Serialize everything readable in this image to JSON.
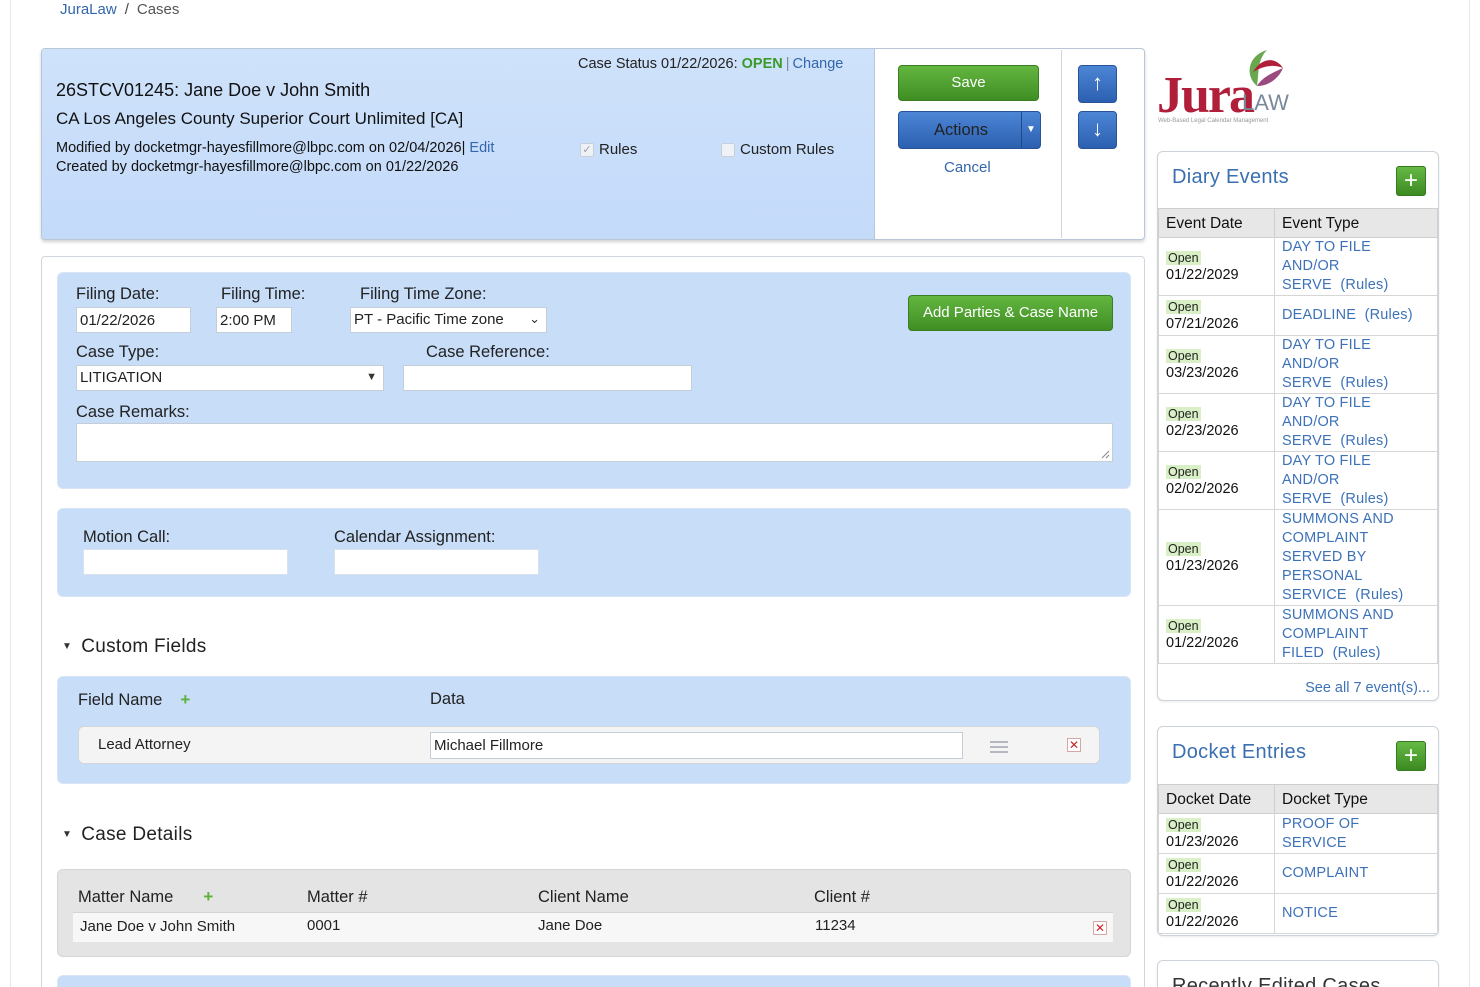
{
  "breadcrumb": {
    "root": "JuraLaw",
    "separator": "/",
    "current": "Cases"
  },
  "header": {
    "case_title": "26STCV01245: Jane Doe v John Smith",
    "court": "CA Los Angeles County Superior Court Unlimited [CA]",
    "modified": "Modified by docketmgr-hayesfillmore@lbpc.com on 02/04/2026|",
    "edit_link": "Edit",
    "created": "Created by docketmgr-hayesfillmore@lbpc.com on 01/22/2026",
    "status_prefix": "Case Status 01/22/2026:",
    "status_value": "OPEN",
    "status_sep": "|",
    "change_link": "Change",
    "rules_label": "Rules",
    "custom_rules_label": "Custom Rules"
  },
  "toolbar": {
    "save_label": "Save",
    "actions_label": "Actions",
    "cancel_label": "Cancel",
    "up_icon": "↑",
    "down_icon": "↓"
  },
  "logo": {
    "jura": "Jura",
    "law": "LAW",
    "tagline": "Web-Based Legal Calendar Management"
  },
  "filing": {
    "filing_date_label": "Filing Date:",
    "filing_date_value": "01/22/2026",
    "filing_time_label": "Filing Time:",
    "filing_time_value": "2:00 PM",
    "time_zone_label": "Filing Time Zone:",
    "time_zone_value": "PT - Pacific Time zone",
    "add_parties_label": "Add Parties & Case Name",
    "case_type_label": "Case Type:",
    "case_type_value": "LITIGATION",
    "case_reference_label": "Case Reference:",
    "case_reference_value": "",
    "case_remarks_label": "Case Remarks:"
  },
  "motion": {
    "motion_call_label": "Motion Call:",
    "calendar_assignment_label": "Calendar Assignment:"
  },
  "custom_fields": {
    "section_title": "Custom Fields",
    "col_field_name": "Field Name",
    "col_data": "Data",
    "rows": [
      {
        "field": "Lead Attorney",
        "data": "Michael Fillmore"
      }
    ]
  },
  "case_details": {
    "section_title": "Case Details",
    "col_matter_name": "Matter Name",
    "col_matter_no": "Matter #",
    "col_client_name": "Client Name",
    "col_client_no": "Client #",
    "rows": [
      {
        "matter_name": "Jane Doe v John Smith",
        "matter_no": "0001",
        "client_name": "Jane Doe",
        "client_no": "11234"
      }
    ]
  },
  "diary": {
    "title": "Diary Events",
    "col_date": "Event Date",
    "col_type": "Event Type",
    "rows": [
      {
        "status": "Open",
        "date": "01/22/2029",
        "type_lines": [
          "DAY TO FILE",
          "AND/OR",
          "SERVE"
        ],
        "rules": "(Rules)"
      },
      {
        "status": "Open",
        "date": "07/21/2026",
        "type_lines": [
          "DEADLINE"
        ],
        "rules": "(Rules)"
      },
      {
        "status": "Open",
        "date": "03/23/2026",
        "type_lines": [
          "DAY TO FILE",
          "AND/OR",
          "SERVE"
        ],
        "rules": "(Rules)"
      },
      {
        "status": "Open",
        "date": "02/23/2026",
        "type_lines": [
          "DAY TO FILE",
          "AND/OR",
          "SERVE"
        ],
        "rules": "(Rules)"
      },
      {
        "status": "Open",
        "date": "02/02/2026",
        "type_lines": [
          "DAY TO FILE",
          "AND/OR",
          "SERVE"
        ],
        "rules": "(Rules)"
      },
      {
        "status": "Open",
        "date": "01/23/2026",
        "type_lines": [
          "SUMMONS AND",
          "COMPLAINT",
          "SERVED BY",
          "PERSONAL",
          "SERVICE"
        ],
        "rules": "(Rules)"
      },
      {
        "status": "Open",
        "date": "01/22/2026",
        "type_lines": [
          "SUMMONS AND",
          "COMPLAINT",
          "FILED"
        ],
        "rules": "(Rules)"
      }
    ],
    "see_all": "See all 7 event(s)..."
  },
  "docket": {
    "title": "Docket Entries",
    "col_date": "Docket Date",
    "col_type": "Docket Type",
    "rows": [
      {
        "status": "Open",
        "date": "01/23/2026",
        "type_lines": [
          "PROOF OF",
          "SERVICE"
        ]
      },
      {
        "status": "Open",
        "date": "01/22/2026",
        "type_lines": [
          "COMPLAINT"
        ]
      },
      {
        "status": "Open",
        "date": "01/22/2026",
        "type_lines": [
          "NOTICE"
        ]
      }
    ]
  },
  "recent": {
    "title": "Recently Edited Cases"
  },
  "colors": {
    "accent_blue": "#3a6fb0",
    "header_blue": "#c7ddf8",
    "save_green": "#4a9e2e",
    "open_green": "#3a9a2a",
    "brand_red": "#b01e3a"
  }
}
